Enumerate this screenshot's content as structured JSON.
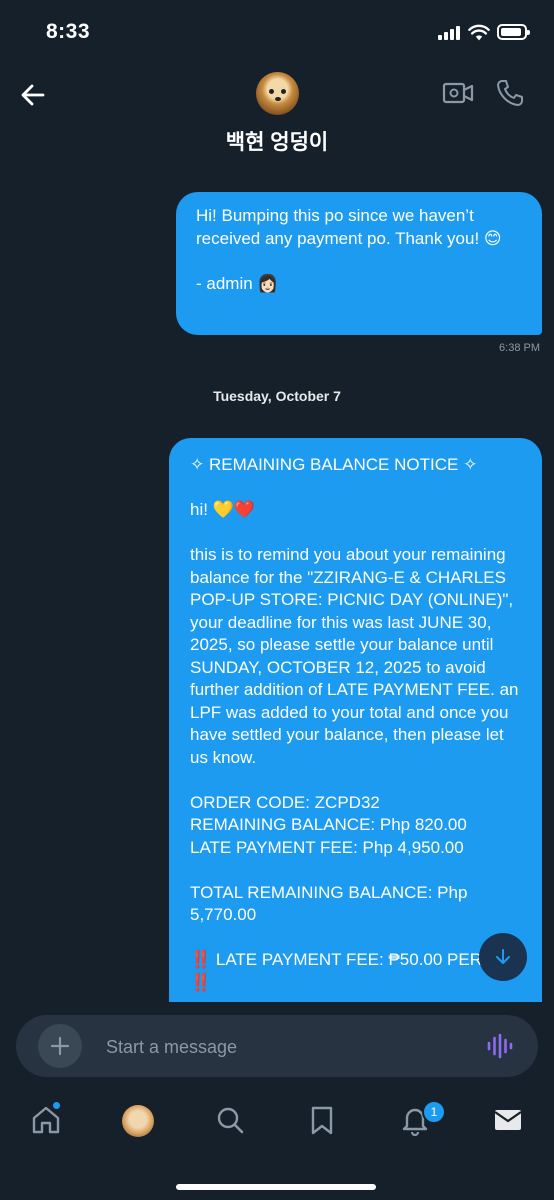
{
  "status_bar": {
    "time": "8:33"
  },
  "header": {
    "contact_name": "백현 엉덩이"
  },
  "messages": [
    {
      "text": "Hi! Bumping this po since we haven’t received any payment po. Thank you! 😊\n\n- admin 👩🏻",
      "time": "6:38 PM"
    },
    {
      "text": "✧ REMAINING BALANCE NOTICE ✧\n\nhi! 💛❤️\n\nthis is to remind you about your remaining balance for the \"ZZIRANG-E & CHARLES POP-UP STORE: PICNIC DAY (ONLINE)\", your deadline for this was last JUNE 30, 2025, so please settle your balance until SUNDAY, OCTOBER 12, 2025 to avoid further addition of LATE PAYMENT FEE. an LPF was added to your total and once you have settled your balance, then please let us know.\n\nORDER CODE: ZCPD32\nREMAINING BALANCE: Php 820.00\nLATE PAYMENT FEE: Php 4,950.00\n\nTOTAL REMAINING BALANCE: Php 5,770.00\n\n‼️ LATE PAYMENT FEE: ₱50.00 PER DAY ‼️"
    }
  ],
  "date_divider": "Tuesday, October 7",
  "composer": {
    "placeholder": "Start a message"
  },
  "tabbar": {
    "notification_count": "1"
  },
  "colors": {
    "background": "#15202b",
    "bubble": "#1d9bf0",
    "accent": "#1d9bf0"
  }
}
